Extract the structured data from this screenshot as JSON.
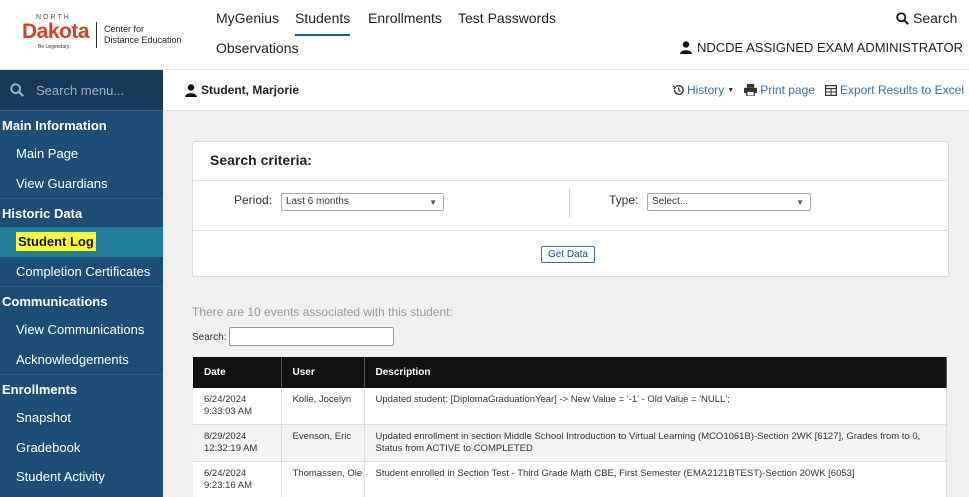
{
  "header": {
    "logo": {
      "north": "NORTH",
      "dakota": "Dakota",
      "tagline": "Be Legendary.",
      "center_line1": "Center for",
      "center_line2": "Distance Education"
    },
    "nav": [
      "MyGenius",
      "Students",
      "Enrollments",
      "Test Passwords",
      "Observations"
    ],
    "active_nav": "Students",
    "search_label": "Search",
    "admin_label": "NDCDE ASSIGNED EXAM ADMINISTRATOR"
  },
  "sidebar": {
    "search_placeholder": "Search menu...",
    "sections": [
      {
        "title": "Main Information",
        "items": [
          "Main Page",
          "View Guardians"
        ]
      },
      {
        "title": "Historic Data",
        "items": [
          "Student Log",
          "Completion Certificates"
        ]
      },
      {
        "title": "Communications",
        "items": [
          "View Communications",
          "Acknowledgements"
        ]
      },
      {
        "title": "Enrollments",
        "items": [
          "Snapshot",
          "Gradebook",
          "Student Activity"
        ]
      }
    ],
    "active_item": "Student Log"
  },
  "subheader": {
    "student_name": "Student, Marjorie",
    "history": "History",
    "print": "Print page",
    "export": "Export Results to Excel"
  },
  "criteria": {
    "title": "Search criteria:",
    "period_label": "Period:",
    "period_value": "Last 6 months",
    "type_label": "Type:",
    "type_value": "Select...",
    "button": "Get Data"
  },
  "results": {
    "summary": "There are 10 events associated with this student:",
    "search_label": "Search:",
    "columns": [
      "Date",
      "User",
      "Description"
    ],
    "rows": [
      {
        "date": "6/24/2024",
        "time": "9:33:03 AM",
        "user": "Kolle, Jocelyn",
        "description": "Updated student: [DiplomaGraduationYear] -> New Value = '-1' - Old Value = 'NULL';"
      },
      {
        "date": "8/29/2024",
        "time": "12:32:19 AM",
        "user": "Evenson, Eric",
        "description": "Updated enrollment in section Middle School Introduction to Virtual Learning (MCO1061B)-Section 2WK [6127], Grades from to 0, Status from ACTIVE to COMPLETED"
      },
      {
        "date": "6/24/2024",
        "time": "9:23:16 AM",
        "user": "Thomassen, Ole",
        "description": "Student enrolled in Section Test - Third Grade Math CBE, First Semester (EMA2121BTEST)-Section 20WK [6053]"
      }
    ]
  }
}
